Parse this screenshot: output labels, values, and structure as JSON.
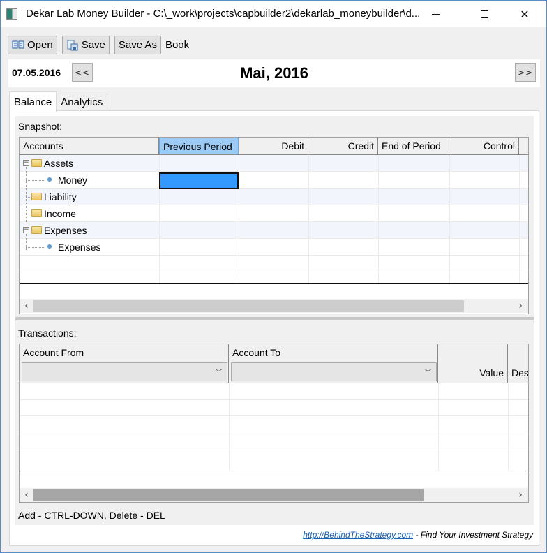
{
  "window": {
    "title": "Dekar Lab Money Builder - C:\\_work\\projects\\capbuilder2\\dekarlab_moneybuilder\\d...",
    "controls": {
      "minimize": "minimize",
      "maximize": "maximize",
      "close": "✕"
    }
  },
  "toolbar": {
    "open_label": "Open",
    "save_label": "Save",
    "save_as_label": "Save As",
    "book_label": "Book"
  },
  "period": {
    "date": "07.05.2016",
    "prev_label": "<<",
    "next_label": ">>",
    "month": "Mai, 2016"
  },
  "tabs": [
    {
      "label": "Balance",
      "active": true
    },
    {
      "label": "Analytics",
      "active": false
    }
  ],
  "snapshot": {
    "label": "Snapshot:",
    "columns": [
      "Accounts",
      "Previous Period",
      "Debit",
      "Credit",
      "End of Period",
      "Control"
    ],
    "selected_column": "Previous Period",
    "rows": [
      {
        "name": "Assets",
        "level": 0,
        "type": "folder",
        "expanded": true
      },
      {
        "name": "Money",
        "level": 1,
        "type": "leaf",
        "selected_cell": "Previous Period"
      },
      {
        "name": "Liability",
        "level": 0,
        "type": "folder",
        "expanded": false
      },
      {
        "name": "Income",
        "level": 0,
        "type": "folder",
        "expanded": false
      },
      {
        "name": "Expenses",
        "level": 0,
        "type": "folder",
        "expanded": true
      },
      {
        "name": "Expenses",
        "level": 1,
        "type": "leaf"
      }
    ],
    "scroll_left": "‹",
    "scroll_right": "›"
  },
  "transactions": {
    "label": "Transactions:",
    "columns": [
      "Account From",
      "Account To",
      "Value",
      "Des"
    ],
    "account_from_value": "",
    "account_to_value": "",
    "scroll_left": "‹",
    "scroll_right": "›"
  },
  "footer": {
    "hint": "Add - CTRL-DOWN, Delete - DEL",
    "link_text": "http://BehindTheStrategy.com",
    "tagline": " - Find Your Investment Strategy"
  },
  "colors": {
    "selection_fill": "#3399ff",
    "selected_header": "#9dcbf5",
    "link": "#1b62b5"
  }
}
